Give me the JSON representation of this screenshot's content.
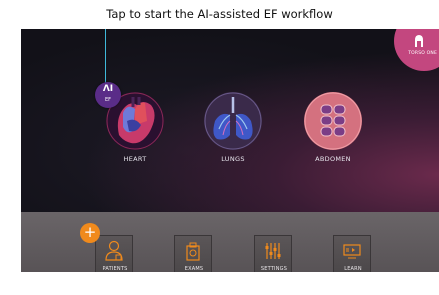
{
  "caption": "Tap to start the AI-assisted EF workflow",
  "brand": {
    "text": "TORSO ONE",
    "icon": "probe-icon",
    "color": "#c3477f"
  },
  "ai_badge": {
    "glyph": "ΛI",
    "label": "EF",
    "color": "#5a2c88"
  },
  "presets": [
    {
      "label": "HEART",
      "icon": "heart-icon"
    },
    {
      "label": "LUNGS",
      "icon": "lungs-icon"
    },
    {
      "label": "ABDOMEN",
      "icon": "abdomen-icon"
    }
  ],
  "add_button": {
    "label": "+",
    "color": "#f08a1c"
  },
  "dock": [
    {
      "label": "PATIENTS",
      "icon": "patient-icon"
    },
    {
      "label": "EXAMS",
      "icon": "exams-icon"
    },
    {
      "label": "SETTINGS",
      "icon": "settings-sliders-icon"
    },
    {
      "label": "LEARN",
      "icon": "learn-video-icon"
    }
  ]
}
